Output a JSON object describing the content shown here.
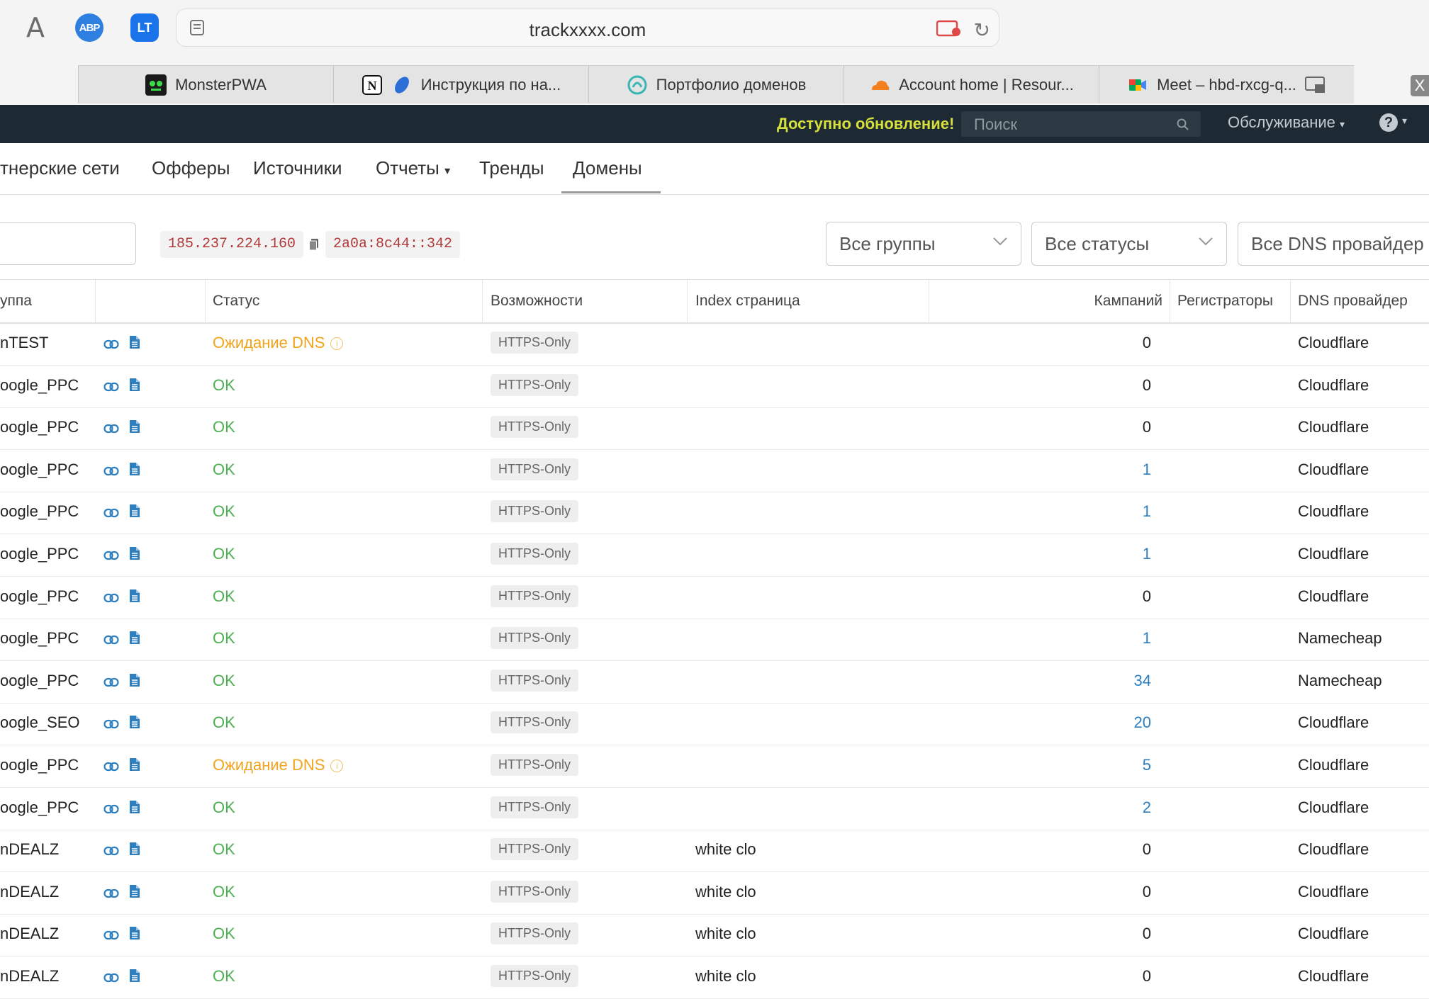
{
  "browser": {
    "url": "trackxxxx.com",
    "extensions": [
      {
        "name": "font-icon",
        "label": "A"
      },
      {
        "name": "adblock-plus-icon",
        "label": "ABP"
      },
      {
        "name": "languagetool-icon",
        "label": "LT"
      }
    ],
    "tabs": [
      {
        "title": "MonsterPWA",
        "icon": "monster-icon"
      },
      {
        "title": "Инструкция по на...",
        "icon": "notion-icon"
      },
      {
        "title": "Портфолио доменов",
        "icon": "domain-portfolio-icon"
      },
      {
        "title": "Account home | Resour...",
        "icon": "cloudflare-icon"
      },
      {
        "title": "Meet – hbd-rxcg-q...",
        "icon": "google-meet-icon"
      }
    ],
    "tab_close": "X"
  },
  "appbar": {
    "update_text": "Доступно обновление!",
    "search_placeholder": "Поиск",
    "service_menu": "Обслуживание",
    "help_label": "?"
  },
  "nav": {
    "items": [
      {
        "label": "тнерские сети"
      },
      {
        "label": "Офферы"
      },
      {
        "label": "Источники"
      },
      {
        "label": "Отчеты"
      },
      {
        "label": "Тренды"
      },
      {
        "label": "Домены"
      }
    ],
    "active": "Домены"
  },
  "filters": {
    "ipv4": "185.237.224.160",
    "ipv6": "2a0a:8c44::342",
    "groups": "Все группы",
    "statuses": "Все статусы",
    "dns": "Все DNS провайдер"
  },
  "table": {
    "headers": {
      "group": "уппа",
      "status": "Статус",
      "features": "Возможности",
      "index": "Index страница",
      "campaigns": "Кампаний",
      "registrars": "Регистраторы",
      "dns": "DNS провайдер"
    },
    "rows": [
      {
        "group": "nTEST",
        "status": "Ожидание DNS",
        "status_type": "wait",
        "badge": "HTTPS-Only",
        "index": "",
        "campaigns": "0",
        "dns": "Cloudflare"
      },
      {
        "group": "oogle_PPC",
        "status": "OK",
        "status_type": "ok",
        "badge": "HTTPS-Only",
        "index": "",
        "campaigns": "0",
        "dns": "Cloudflare"
      },
      {
        "group": "oogle_PPC",
        "status": "OK",
        "status_type": "ok",
        "badge": "HTTPS-Only",
        "index": "",
        "campaigns": "0",
        "dns": "Cloudflare"
      },
      {
        "group": "oogle_PPC",
        "status": "OK",
        "status_type": "ok",
        "badge": "HTTPS-Only",
        "index": "",
        "campaigns": "1",
        "dns": "Cloudflare"
      },
      {
        "group": "oogle_PPC",
        "status": "OK",
        "status_type": "ok",
        "badge": "HTTPS-Only",
        "index": "",
        "campaigns": "1",
        "dns": "Cloudflare"
      },
      {
        "group": "oogle_PPC",
        "status": "OK",
        "status_type": "ok",
        "badge": "HTTPS-Only",
        "index": "",
        "campaigns": "1",
        "dns": "Cloudflare"
      },
      {
        "group": "oogle_PPC",
        "status": "OK",
        "status_type": "ok",
        "badge": "HTTPS-Only",
        "index": "",
        "campaigns": "0",
        "dns": "Cloudflare"
      },
      {
        "group": "oogle_PPC",
        "status": "OK",
        "status_type": "ok",
        "badge": "HTTPS-Only",
        "index": "",
        "campaigns": "1",
        "dns": "Namecheap"
      },
      {
        "group": "oogle_PPC",
        "status": "OK",
        "status_type": "ok",
        "badge": "HTTPS-Only",
        "index": "",
        "campaigns": "34",
        "dns": "Namecheap"
      },
      {
        "group": "oogle_SEO",
        "status": "OK",
        "status_type": "ok",
        "badge": "HTTPS-Only",
        "index": "",
        "campaigns": "20",
        "dns": "Cloudflare"
      },
      {
        "group": "oogle_PPC",
        "status": "Ожидание DNS",
        "status_type": "wait",
        "badge": "HTTPS-Only",
        "index": "",
        "campaigns": "5",
        "dns": "Cloudflare"
      },
      {
        "group": "oogle_PPC",
        "status": "OK",
        "status_type": "ok",
        "badge": "HTTPS-Only",
        "index": "",
        "campaigns": "2",
        "dns": "Cloudflare"
      },
      {
        "group": "nDEALZ",
        "status": "OK",
        "status_type": "ok",
        "badge": "HTTPS-Only",
        "index": "white clo",
        "campaigns": "0",
        "dns": "Cloudflare"
      },
      {
        "group": "nDEALZ",
        "status": "OK",
        "status_type": "ok",
        "badge": "HTTPS-Only",
        "index": "white clo",
        "campaigns": "0",
        "dns": "Cloudflare"
      },
      {
        "group": "nDEALZ",
        "status": "OK",
        "status_type": "ok",
        "badge": "HTTPS-Only",
        "index": "white clo",
        "campaigns": "0",
        "dns": "Cloudflare"
      },
      {
        "group": "nDEALZ",
        "status": "OK",
        "status_type": "ok",
        "badge": "HTTPS-Only",
        "index": "white clo",
        "campaigns": "0",
        "dns": "Cloudflare"
      }
    ]
  },
  "colors": {
    "appbar_bg": "#1e2a33",
    "update_text": "#d6df3c",
    "status_ok": "#4caf50",
    "status_wait": "#f0a31c",
    "link_blue": "#2d7fc0",
    "ip_text": "#b03a3a"
  }
}
